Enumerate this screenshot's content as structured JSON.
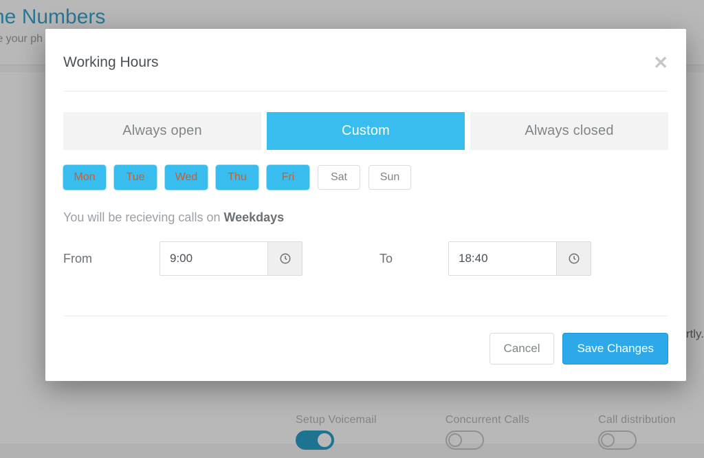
{
  "background": {
    "title_fragment": "he Numbers",
    "subtitle_fragment": "re your ph",
    "right_text": "shortly.",
    "settings": [
      {
        "label": "Setup Voicemail",
        "on": true
      },
      {
        "label": "Concurrent Calls",
        "on": false
      },
      {
        "label": "Call distribution",
        "on": false
      }
    ]
  },
  "modal": {
    "title": "Working Hours",
    "tabs": [
      {
        "label": "Always open",
        "active": false
      },
      {
        "label": "Custom",
        "active": true
      },
      {
        "label": "Always closed",
        "active": false
      }
    ],
    "days": [
      {
        "label": "Mon",
        "active": true
      },
      {
        "label": "Tue",
        "active": true
      },
      {
        "label": "Wed",
        "active": true
      },
      {
        "label": "Thu",
        "active": true
      },
      {
        "label": "Fri",
        "active": true
      },
      {
        "label": "Sat",
        "active": false
      },
      {
        "label": "Sun",
        "active": false
      }
    ],
    "info_prefix": "You will be recieving calls on ",
    "info_bold": "Weekdays",
    "from_label": "From",
    "to_label": "To",
    "from_value": "9:00",
    "to_value": "18:40",
    "cancel_label": "Cancel",
    "save_label": "Save Changes"
  }
}
